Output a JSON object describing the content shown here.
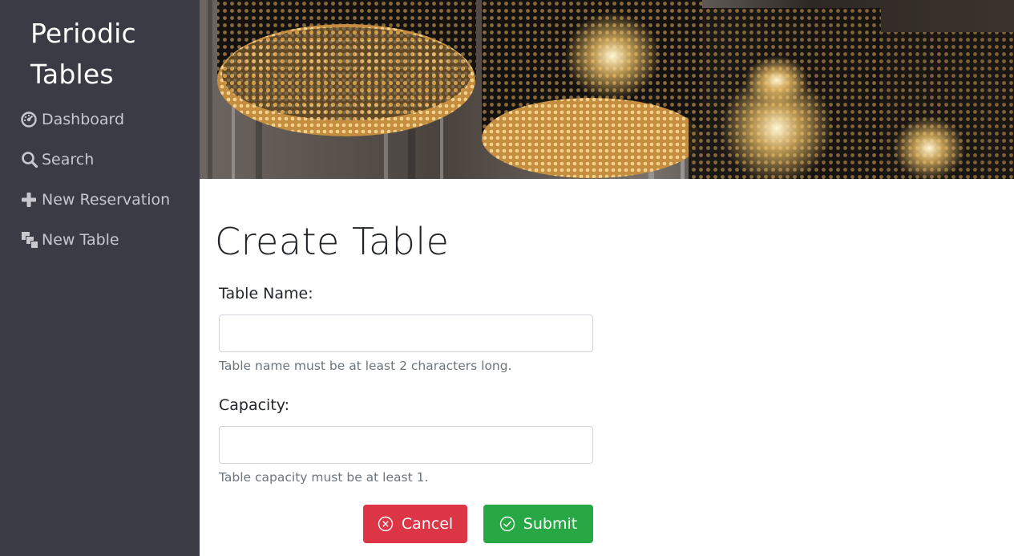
{
  "sidebar": {
    "brand": "Periodic Tables",
    "items": [
      {
        "label": "Dashboard",
        "icon": "dashboard-icon"
      },
      {
        "label": "Search",
        "icon": "search-icon"
      },
      {
        "label": "New Reservation",
        "icon": "plus-icon"
      },
      {
        "label": "New Table",
        "icon": "layers-icon"
      }
    ]
  },
  "banner": {
    "icon": "pendant-lamps-photo"
  },
  "form": {
    "title": "Create Table",
    "table_name": {
      "label": "Table Name:",
      "value": "",
      "help": "Table name must be at least 2 characters long."
    },
    "capacity": {
      "label": "Capacity:",
      "value": "",
      "help": "Table capacity must be at least 1."
    },
    "cancel_label": "Cancel",
    "submit_label": "Submit"
  },
  "colors": {
    "sidebar_bg": "#3b3b45",
    "cancel": "#dc3545",
    "submit": "#28a745"
  }
}
